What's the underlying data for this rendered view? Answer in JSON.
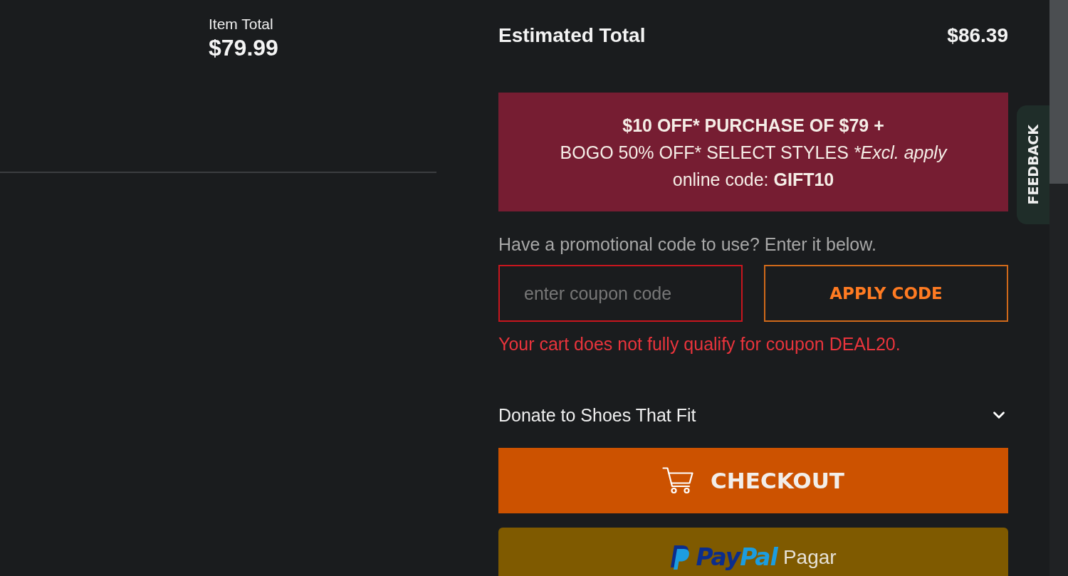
{
  "item_total": {
    "label": "Item Total",
    "price": "$79.99"
  },
  "estimated_total": {
    "label": "Estimated Total",
    "amount": "$86.39"
  },
  "promo_banner": {
    "headline": "$10 OFF* PURCHASE OF $79 +",
    "offer": "BOGO 50% OFF* SELECT STYLES",
    "offer_note": "*Excl. apply",
    "code_label": "online code:",
    "code": "GIFT10"
  },
  "promo_code": {
    "prompt": "Have a promotional code to use? Enter it below.",
    "input": {
      "placeholder": "enter coupon code",
      "invalid": true
    },
    "apply_button": "APPLY CODE",
    "error": "Your cart does not fully qualify for coupon DEAL20."
  },
  "donation": {
    "label": "Donate to Shoes That Fit",
    "expanded": false
  },
  "checkout_button": {
    "label": "CHECKOUT"
  },
  "paypal_button": {
    "wordmark": [
      "Pay",
      "Pal"
    ],
    "label": "Pagar"
  },
  "feedback_tab": {
    "label": "FEEDBACK"
  }
}
